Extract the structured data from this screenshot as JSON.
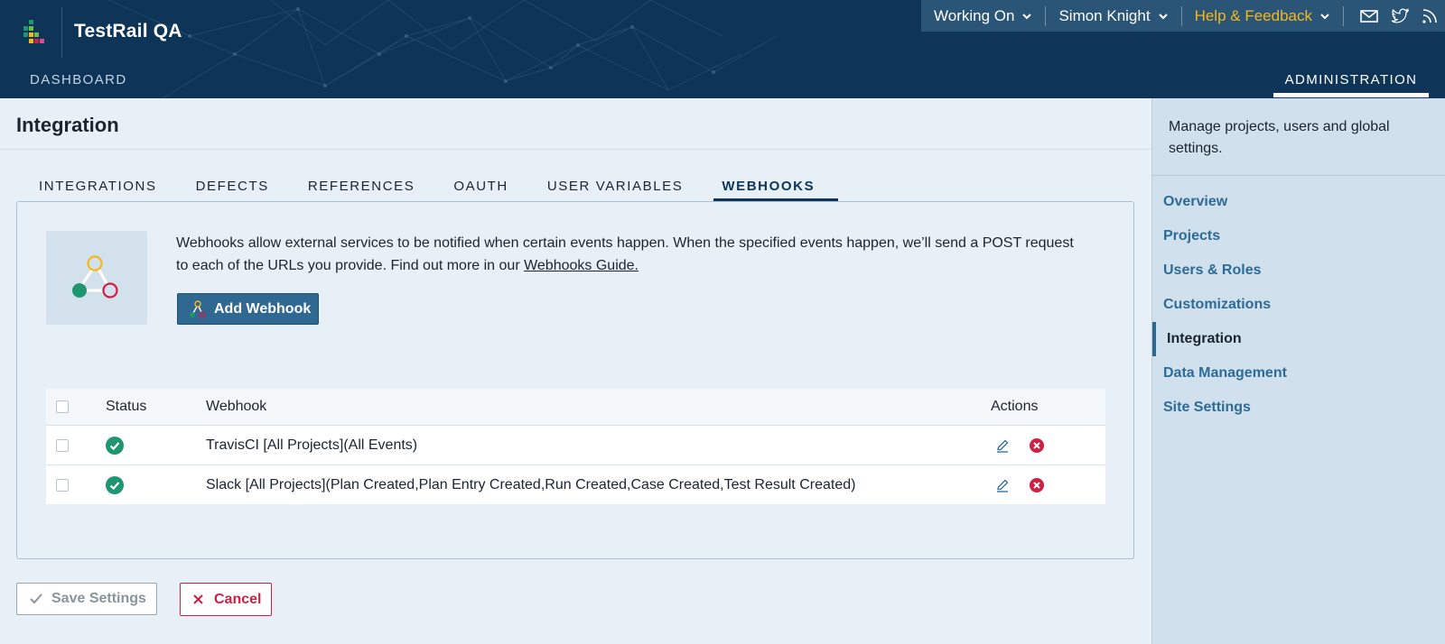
{
  "app": {
    "title": "TestRail QA"
  },
  "topnav": {
    "working_on": "Working On",
    "user": "Simon Knight",
    "help": "Help & Feedback",
    "icons": [
      "mail-icon",
      "twitter-icon",
      "rss-icon"
    ],
    "help_color": "#f6b81a"
  },
  "main_nav": {
    "dashboard": "DASHBOARD",
    "administration": "ADMINISTRATION"
  },
  "page": {
    "title": "Integration"
  },
  "tabs": [
    {
      "label": "INTEGRATIONS",
      "active": false
    },
    {
      "label": "DEFECTS",
      "active": false
    },
    {
      "label": "REFERENCES",
      "active": false
    },
    {
      "label": "OAUTH",
      "active": false
    },
    {
      "label": "USER VARIABLES",
      "active": false
    },
    {
      "label": "WEBHOOKS",
      "active": true
    }
  ],
  "webhooks": {
    "intro": "Webhooks allow external services to be notified when certain events happen. When the specified events happen, we’ll send a POST request to each of the URLs you provide. Find out more in our ",
    "guide_link": "Webhooks Guide.",
    "add_button": "Add Webhook",
    "table": {
      "headers": {
        "status": "Status",
        "webhook": "Webhook",
        "actions": "Actions"
      },
      "rows": [
        {
          "status": "active",
          "webhook": "TravisCI [All Projects](All Events)"
        },
        {
          "status": "active",
          "webhook": "Slack [All Projects](Plan Created,Plan Entry Created,Run Created,Case Created,Test Result Created)"
        }
      ]
    }
  },
  "footer": {
    "save": "Save Settings",
    "cancel": "Cancel"
  },
  "sidebar": {
    "description": "Manage projects, users and global settings.",
    "items": [
      {
        "label": "Overview",
        "active": false
      },
      {
        "label": "Projects",
        "active": false
      },
      {
        "label": "Users & Roles",
        "active": false
      },
      {
        "label": "Customizations",
        "active": false
      },
      {
        "label": "Integration",
        "active": true
      },
      {
        "label": "Data Management",
        "active": false
      },
      {
        "label": "Site Settings",
        "active": false
      }
    ]
  },
  "colors": {
    "header_bg": "#0e3557",
    "accent": "#2f6891",
    "status_ok": "#1f9670",
    "danger": "#cf1f43"
  }
}
